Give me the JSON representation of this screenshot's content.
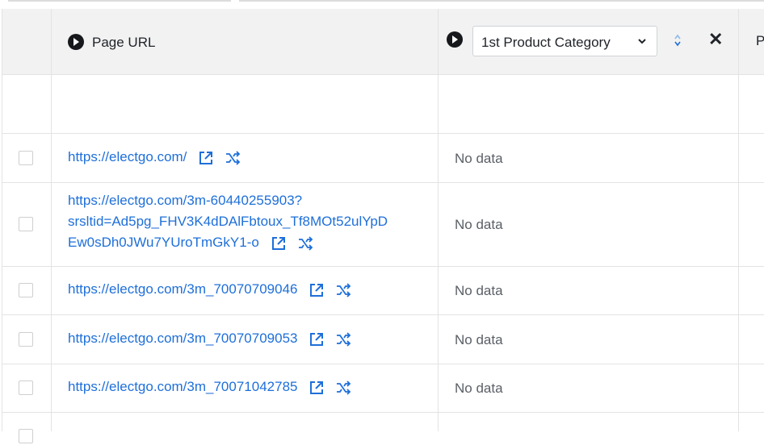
{
  "header": {
    "col_page_url": "Page URL",
    "col_category_select": "1st Product Category",
    "col_next_partial": "P"
  },
  "rows": [
    {
      "url_lines": [
        "https://electgo.com/"
      ],
      "category": "No data"
    },
    {
      "url_lines": [
        "https://electgo.com/3m-60440255903?",
        "srsltid=Ad5pg_FHV3K4dDAlFbtoux_Tf8MOt52ulYpD",
        "Ew0sDh0JWu7YUroTmGkY1-o"
      ],
      "category": "No data"
    },
    {
      "url_lines": [
        "https://electgo.com/3m_70070709046"
      ],
      "category": "No data"
    },
    {
      "url_lines": [
        "https://electgo.com/3m_70070709053"
      ],
      "category": "No data"
    },
    {
      "url_lines": [
        "https://electgo.com/3m_70071042785"
      ],
      "category": "No data"
    }
  ],
  "colors": {
    "link": "#1e6fd9",
    "header_bg": "#f2f2f2",
    "border": "#e3e3e3"
  },
  "icons": [
    "play-icon",
    "chevron-down-icon",
    "sort-icon",
    "close-icon",
    "external-link-icon",
    "shuffle-icon"
  ]
}
